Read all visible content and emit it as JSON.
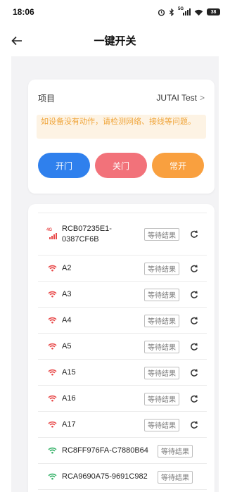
{
  "status_bar": {
    "time": "18:06",
    "signal_label": "5G",
    "battery": "38"
  },
  "nav": {
    "title": "一键开关"
  },
  "project": {
    "label": "项目",
    "value": "JUTAI Test",
    "chevron": ">"
  },
  "warning": {
    "text": "如设备没有动作，请检测网络、接线等问题。"
  },
  "buttons": {
    "open": "开门",
    "close": "关门",
    "always_open": "常开"
  },
  "colors": {
    "open": "#2f80ed",
    "close": "#f2727a",
    "always_open": "#f9a03f",
    "wifi_red": "#e84a4a",
    "wifi_green": "#39b36b",
    "warning_text": "#f0a53a",
    "warning_bg": "#fdf3e4"
  },
  "devices": [
    {
      "name_line1": "RCB07235E1-",
      "name_line2": "0387CF6B",
      "icon": "cellular-4g-icon",
      "icon_label": "4G",
      "status": "等待结果",
      "refresh": true
    },
    {
      "name_line1": "A2",
      "icon": "wifi-red-icon",
      "status": "等待结果",
      "refresh": true
    },
    {
      "name_line1": "A3",
      "icon": "wifi-red-icon",
      "status": "等待结果",
      "refresh": true
    },
    {
      "name_line1": "A4",
      "icon": "wifi-red-icon",
      "status": "等待结果",
      "refresh": true
    },
    {
      "name_line1": "A5",
      "icon": "wifi-red-icon",
      "status": "等待结果",
      "refresh": true
    },
    {
      "name_line1": "A15",
      "icon": "wifi-red-icon",
      "status": "等待结果",
      "refresh": true
    },
    {
      "name_line1": "A16",
      "icon": "wifi-red-icon",
      "status": "等待结果",
      "refresh": true
    },
    {
      "name_line1": "A17",
      "icon": "wifi-red-icon",
      "status": "等待结果",
      "refresh": true
    },
    {
      "name_line1": "RC8FF976FA-C7880B64",
      "icon": "wifi-green-icon",
      "status": "等待结果",
      "refresh": false
    },
    {
      "name_line1": "RCA9690A75-9691C982",
      "icon": "wifi-green-icon",
      "status": "等待结果",
      "refresh": false
    }
  ]
}
